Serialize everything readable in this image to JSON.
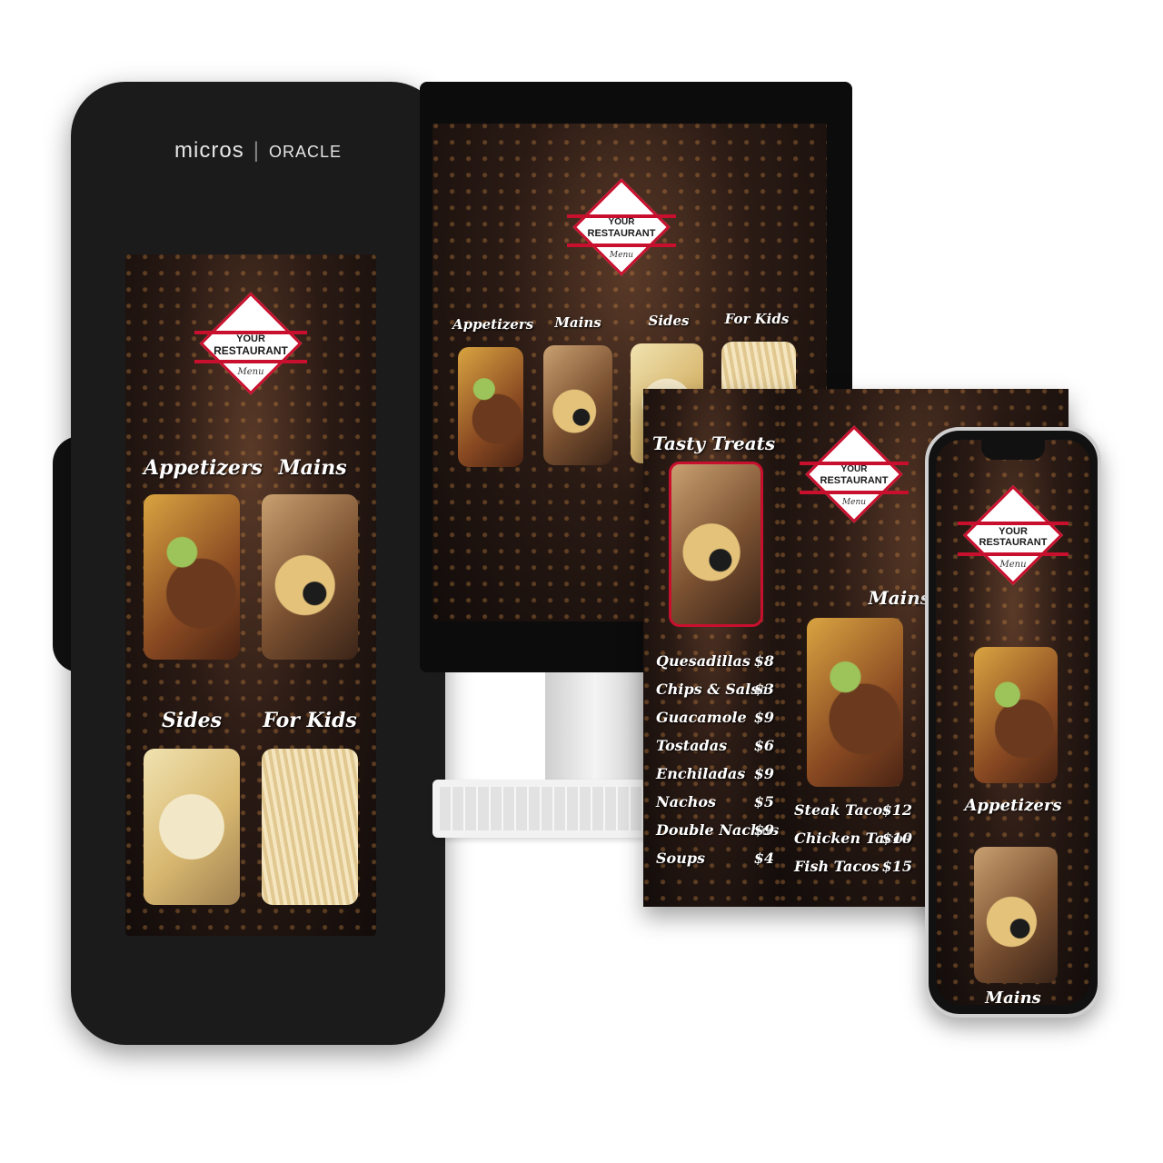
{
  "brand": {
    "left": "micros",
    "right": "ORACLE"
  },
  "logo": {
    "line1": "YOUR",
    "line2": "RESTAURANT",
    "line3": "Menu"
  },
  "sections": {
    "appetizers": "Appetizers",
    "mains": "Mains",
    "sides": "Sides",
    "for_kids": "For Kids",
    "tasty_treats": "Tasty Treats"
  },
  "price_list": [
    {
      "name": "Quesadillas",
      "price": "$8"
    },
    {
      "name": "Chips & Salsa",
      "price": "$3"
    },
    {
      "name": "Guacamole",
      "price": "$9"
    },
    {
      "name": "Tostadas",
      "price": "$6"
    },
    {
      "name": "Enchiladas",
      "price": "$9"
    },
    {
      "name": "Nachos",
      "price": "$5"
    },
    {
      "name": "Double Nachos",
      "price": "$9"
    },
    {
      "name": "Soups",
      "price": "$4"
    }
  ],
  "mains_list": [
    {
      "name": "Steak Tacos",
      "price": "$12"
    },
    {
      "name": "Chicken Tacos",
      "price": "$10"
    },
    {
      "name": "Fish Tacos",
      "price": "$15"
    }
  ],
  "colors": {
    "accent": "#c8102e",
    "device": "#1b1b1b"
  }
}
